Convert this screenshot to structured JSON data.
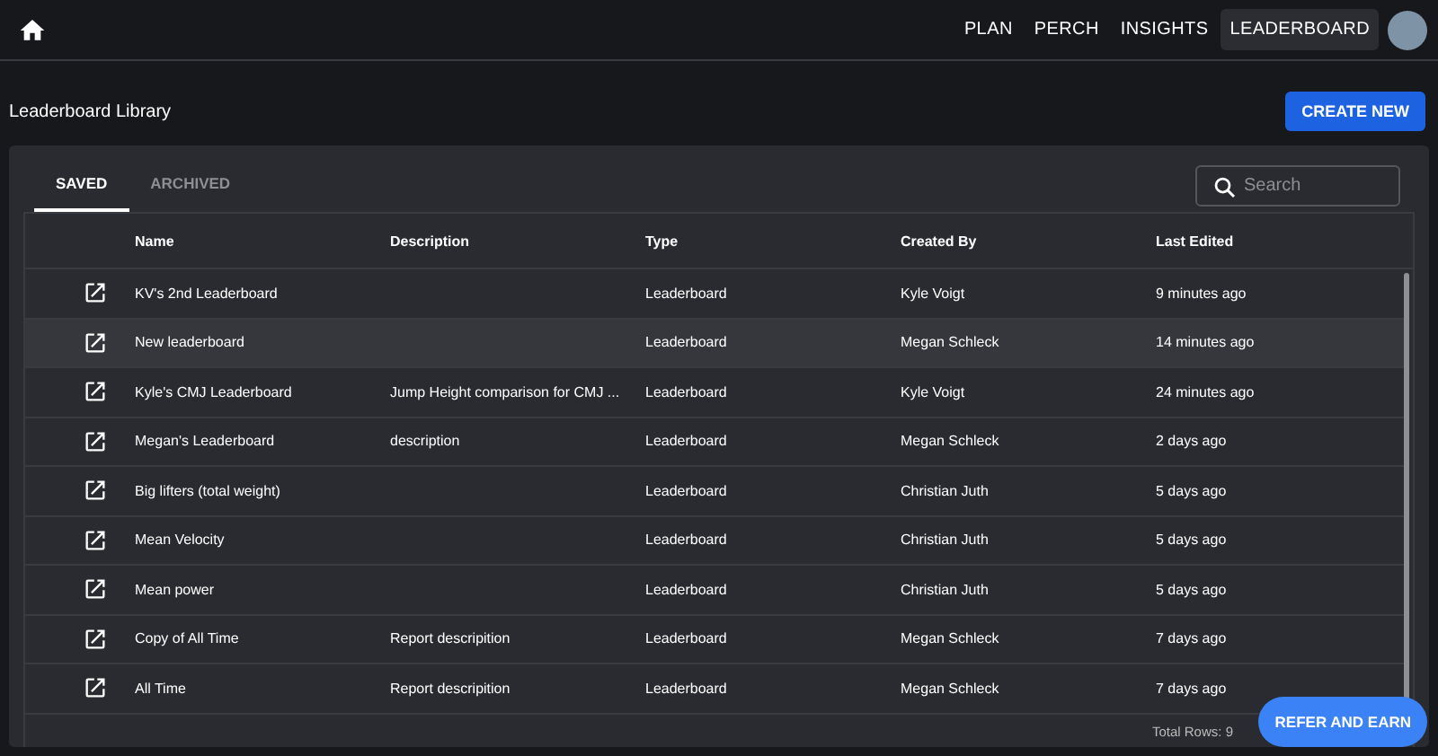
{
  "nav": {
    "items": [
      {
        "label": "PLAN",
        "selected": false
      },
      {
        "label": "PERCH",
        "selected": false
      },
      {
        "label": "INSIGHTS",
        "selected": false
      },
      {
        "label": "LEADERBOARD",
        "selected": true
      }
    ]
  },
  "page": {
    "title": "Leaderboard Library",
    "create_button": "CREATE NEW"
  },
  "tabs": [
    {
      "label": "SAVED",
      "selected": true
    },
    {
      "label": "ARCHIVED",
      "selected": false
    }
  ],
  "search": {
    "placeholder": "Search"
  },
  "table": {
    "columns": [
      "Name",
      "Description",
      "Type",
      "Created By",
      "Last Edited"
    ],
    "rows": [
      {
        "name": "KV's 2nd Leaderboard",
        "description": "",
        "type": "Leaderboard",
        "created_by": "Kyle Voigt",
        "last_edited": "9 minutes ago",
        "selected": false
      },
      {
        "name": "New leaderboard",
        "description": "",
        "type": "Leaderboard",
        "created_by": "Megan Schleck",
        "last_edited": "14 minutes ago",
        "selected": true
      },
      {
        "name": "Kyle's CMJ Leaderboard",
        "description": "Jump Height comparison for CMJ ...",
        "type": "Leaderboard",
        "created_by": "Kyle Voigt",
        "last_edited": "24 minutes ago",
        "selected": false
      },
      {
        "name": "Megan's Leaderboard",
        "description": "description",
        "type": "Leaderboard",
        "created_by": "Megan Schleck",
        "last_edited": "2 days ago",
        "selected": false
      },
      {
        "name": "Big lifters (total weight)",
        "description": "",
        "type": "Leaderboard",
        "created_by": "Christian Juth",
        "last_edited": "5 days ago",
        "selected": false
      },
      {
        "name": "Mean Velocity",
        "description": "",
        "type": "Leaderboard",
        "created_by": "Christian Juth",
        "last_edited": "5 days ago",
        "selected": false
      },
      {
        "name": "Mean power",
        "description": "",
        "type": "Leaderboard",
        "created_by": "Christian Juth",
        "last_edited": "5 days ago",
        "selected": false
      },
      {
        "name": "Copy of All Time",
        "description": "Report descripition",
        "type": "Leaderboard",
        "created_by": "Megan Schleck",
        "last_edited": "7 days ago",
        "selected": false
      },
      {
        "name": "All Time",
        "description": "Report descripition",
        "type": "Leaderboard",
        "created_by": "Megan Schleck",
        "last_edited": "7 days ago",
        "selected": false
      }
    ],
    "footer": "Total Rows: 9"
  },
  "fab": "REFER AND EARN"
}
